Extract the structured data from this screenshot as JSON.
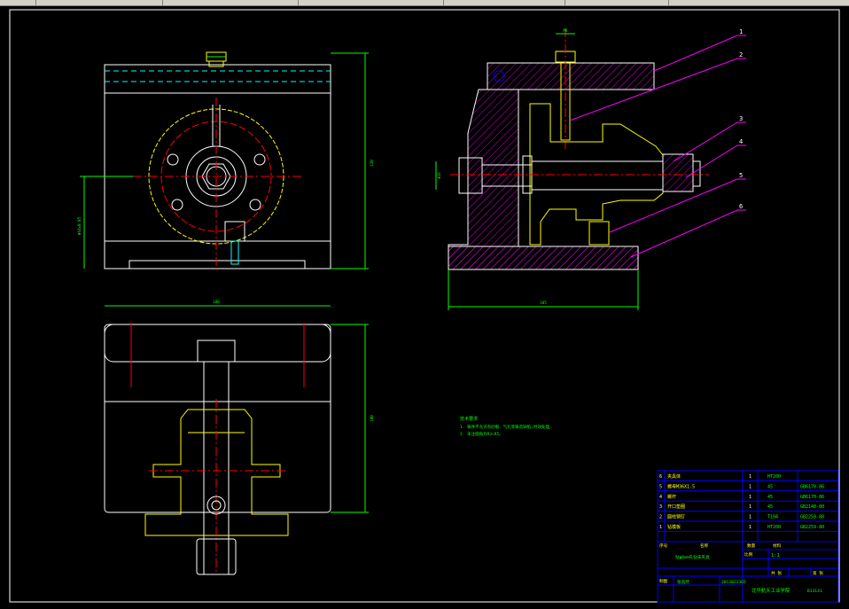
{
  "window": {
    "title_bar_visible": true
  },
  "colors": {
    "background": "#000000",
    "outline": "#ffffff",
    "part": "#ffff00",
    "centerline": "#ff0000",
    "dimension": "#00ff00",
    "leader": "#ff00ff",
    "bolt": "#00ffff",
    "frame": "#0000ff"
  },
  "leaders": [
    "1",
    "2",
    "3",
    "4",
    "5",
    "6"
  ],
  "dimensions": {
    "side_height": "130",
    "bottom_height": "100",
    "front_width": "185",
    "bottom_width": "180",
    "bore_dia": "Φ64±0.05",
    "section_width": "185",
    "section_bore": "Φ26",
    "top_fit": "M8"
  },
  "notes": {
    "title": "技术要求",
    "line1": "1. 铸件不允许有砂眼、气孔等铸造缺陷;时效处理。",
    "line2": "2. 未注圆角为R3~R5。"
  },
  "bom": [
    {
      "no": "6",
      "name": "夹具体",
      "qty": "1",
      "material": "HT200",
      "std": ""
    },
    {
      "no": "5",
      "name": "螺母M36X1.5",
      "qty": "1",
      "material": "45",
      "std": "GB6170-86"
    },
    {
      "no": "4",
      "name": "螺杆",
      "qty": "1",
      "material": "45",
      "std": "GB6170-86"
    },
    {
      "no": "3",
      "name": "开口垫圈",
      "qty": "1",
      "material": "45",
      "std": "GB2148-80"
    },
    {
      "no": "2",
      "name": "圆柱销钉",
      "qty": "1",
      "material": "T10A",
      "std": "GB2259-80"
    },
    {
      "no": "1",
      "name": "钻模板",
      "qty": "1",
      "material": "HT200",
      "std": "GB2259-80"
    }
  ],
  "title_block": {
    "h_no": "序号",
    "h_name": "名称",
    "h_qty": "数量",
    "h_material": "材料",
    "drawing_name": "钻ф6mm孔钻床夹具",
    "scale_label": "比例",
    "scale": "1:1",
    "sheet_label": "共 张",
    "sheet2_label": "第 张",
    "designer_label": "制图",
    "designer": "张浩然",
    "date": "2013022365",
    "school": "北华航天工业学院",
    "class_code": "B13141"
  }
}
